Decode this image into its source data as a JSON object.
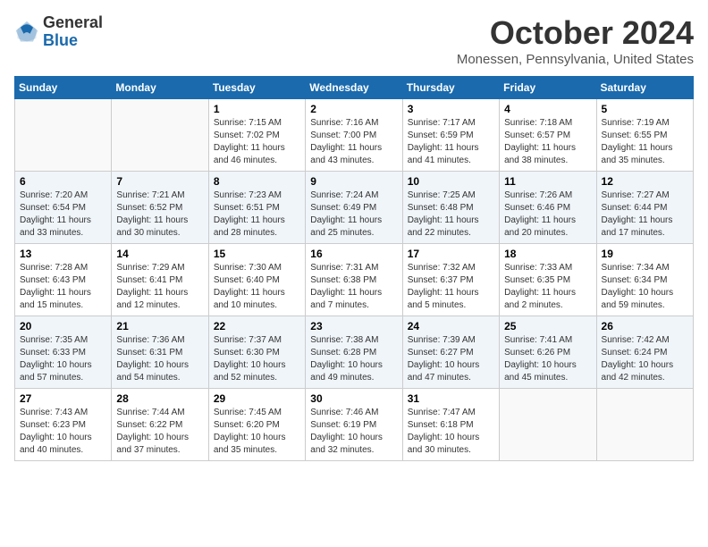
{
  "logo": {
    "general": "General",
    "blue": "Blue"
  },
  "title": "October 2024",
  "location": "Monessen, Pennsylvania, United States",
  "days_of_week": [
    "Sunday",
    "Monday",
    "Tuesday",
    "Wednesday",
    "Thursday",
    "Friday",
    "Saturday"
  ],
  "weeks": [
    [
      {
        "day": "",
        "sunrise": "",
        "sunset": "",
        "daylight": ""
      },
      {
        "day": "",
        "sunrise": "",
        "sunset": "",
        "daylight": ""
      },
      {
        "day": "1",
        "sunrise": "Sunrise: 7:15 AM",
        "sunset": "Sunset: 7:02 PM",
        "daylight": "Daylight: 11 hours and 46 minutes."
      },
      {
        "day": "2",
        "sunrise": "Sunrise: 7:16 AM",
        "sunset": "Sunset: 7:00 PM",
        "daylight": "Daylight: 11 hours and 43 minutes."
      },
      {
        "day": "3",
        "sunrise": "Sunrise: 7:17 AM",
        "sunset": "Sunset: 6:59 PM",
        "daylight": "Daylight: 11 hours and 41 minutes."
      },
      {
        "day": "4",
        "sunrise": "Sunrise: 7:18 AM",
        "sunset": "Sunset: 6:57 PM",
        "daylight": "Daylight: 11 hours and 38 minutes."
      },
      {
        "day": "5",
        "sunrise": "Sunrise: 7:19 AM",
        "sunset": "Sunset: 6:55 PM",
        "daylight": "Daylight: 11 hours and 35 minutes."
      }
    ],
    [
      {
        "day": "6",
        "sunrise": "Sunrise: 7:20 AM",
        "sunset": "Sunset: 6:54 PM",
        "daylight": "Daylight: 11 hours and 33 minutes."
      },
      {
        "day": "7",
        "sunrise": "Sunrise: 7:21 AM",
        "sunset": "Sunset: 6:52 PM",
        "daylight": "Daylight: 11 hours and 30 minutes."
      },
      {
        "day": "8",
        "sunrise": "Sunrise: 7:23 AM",
        "sunset": "Sunset: 6:51 PM",
        "daylight": "Daylight: 11 hours and 28 minutes."
      },
      {
        "day": "9",
        "sunrise": "Sunrise: 7:24 AM",
        "sunset": "Sunset: 6:49 PM",
        "daylight": "Daylight: 11 hours and 25 minutes."
      },
      {
        "day": "10",
        "sunrise": "Sunrise: 7:25 AM",
        "sunset": "Sunset: 6:48 PM",
        "daylight": "Daylight: 11 hours and 22 minutes."
      },
      {
        "day": "11",
        "sunrise": "Sunrise: 7:26 AM",
        "sunset": "Sunset: 6:46 PM",
        "daylight": "Daylight: 11 hours and 20 minutes."
      },
      {
        "day": "12",
        "sunrise": "Sunrise: 7:27 AM",
        "sunset": "Sunset: 6:44 PM",
        "daylight": "Daylight: 11 hours and 17 minutes."
      }
    ],
    [
      {
        "day": "13",
        "sunrise": "Sunrise: 7:28 AM",
        "sunset": "Sunset: 6:43 PM",
        "daylight": "Daylight: 11 hours and 15 minutes."
      },
      {
        "day": "14",
        "sunrise": "Sunrise: 7:29 AM",
        "sunset": "Sunset: 6:41 PM",
        "daylight": "Daylight: 11 hours and 12 minutes."
      },
      {
        "day": "15",
        "sunrise": "Sunrise: 7:30 AM",
        "sunset": "Sunset: 6:40 PM",
        "daylight": "Daylight: 11 hours and 10 minutes."
      },
      {
        "day": "16",
        "sunrise": "Sunrise: 7:31 AM",
        "sunset": "Sunset: 6:38 PM",
        "daylight": "Daylight: 11 hours and 7 minutes."
      },
      {
        "day": "17",
        "sunrise": "Sunrise: 7:32 AM",
        "sunset": "Sunset: 6:37 PM",
        "daylight": "Daylight: 11 hours and 5 minutes."
      },
      {
        "day": "18",
        "sunrise": "Sunrise: 7:33 AM",
        "sunset": "Sunset: 6:35 PM",
        "daylight": "Daylight: 11 hours and 2 minutes."
      },
      {
        "day": "19",
        "sunrise": "Sunrise: 7:34 AM",
        "sunset": "Sunset: 6:34 PM",
        "daylight": "Daylight: 10 hours and 59 minutes."
      }
    ],
    [
      {
        "day": "20",
        "sunrise": "Sunrise: 7:35 AM",
        "sunset": "Sunset: 6:33 PM",
        "daylight": "Daylight: 10 hours and 57 minutes."
      },
      {
        "day": "21",
        "sunrise": "Sunrise: 7:36 AM",
        "sunset": "Sunset: 6:31 PM",
        "daylight": "Daylight: 10 hours and 54 minutes."
      },
      {
        "day": "22",
        "sunrise": "Sunrise: 7:37 AM",
        "sunset": "Sunset: 6:30 PM",
        "daylight": "Daylight: 10 hours and 52 minutes."
      },
      {
        "day": "23",
        "sunrise": "Sunrise: 7:38 AM",
        "sunset": "Sunset: 6:28 PM",
        "daylight": "Daylight: 10 hours and 49 minutes."
      },
      {
        "day": "24",
        "sunrise": "Sunrise: 7:39 AM",
        "sunset": "Sunset: 6:27 PM",
        "daylight": "Daylight: 10 hours and 47 minutes."
      },
      {
        "day": "25",
        "sunrise": "Sunrise: 7:41 AM",
        "sunset": "Sunset: 6:26 PM",
        "daylight": "Daylight: 10 hours and 45 minutes."
      },
      {
        "day": "26",
        "sunrise": "Sunrise: 7:42 AM",
        "sunset": "Sunset: 6:24 PM",
        "daylight": "Daylight: 10 hours and 42 minutes."
      }
    ],
    [
      {
        "day": "27",
        "sunrise": "Sunrise: 7:43 AM",
        "sunset": "Sunset: 6:23 PM",
        "daylight": "Daylight: 10 hours and 40 minutes."
      },
      {
        "day": "28",
        "sunrise": "Sunrise: 7:44 AM",
        "sunset": "Sunset: 6:22 PM",
        "daylight": "Daylight: 10 hours and 37 minutes."
      },
      {
        "day": "29",
        "sunrise": "Sunrise: 7:45 AM",
        "sunset": "Sunset: 6:20 PM",
        "daylight": "Daylight: 10 hours and 35 minutes."
      },
      {
        "day": "30",
        "sunrise": "Sunrise: 7:46 AM",
        "sunset": "Sunset: 6:19 PM",
        "daylight": "Daylight: 10 hours and 32 minutes."
      },
      {
        "day": "31",
        "sunrise": "Sunrise: 7:47 AM",
        "sunset": "Sunset: 6:18 PM",
        "daylight": "Daylight: 10 hours and 30 minutes."
      },
      {
        "day": "",
        "sunrise": "",
        "sunset": "",
        "daylight": ""
      },
      {
        "day": "",
        "sunrise": "",
        "sunset": "",
        "daylight": ""
      }
    ]
  ]
}
